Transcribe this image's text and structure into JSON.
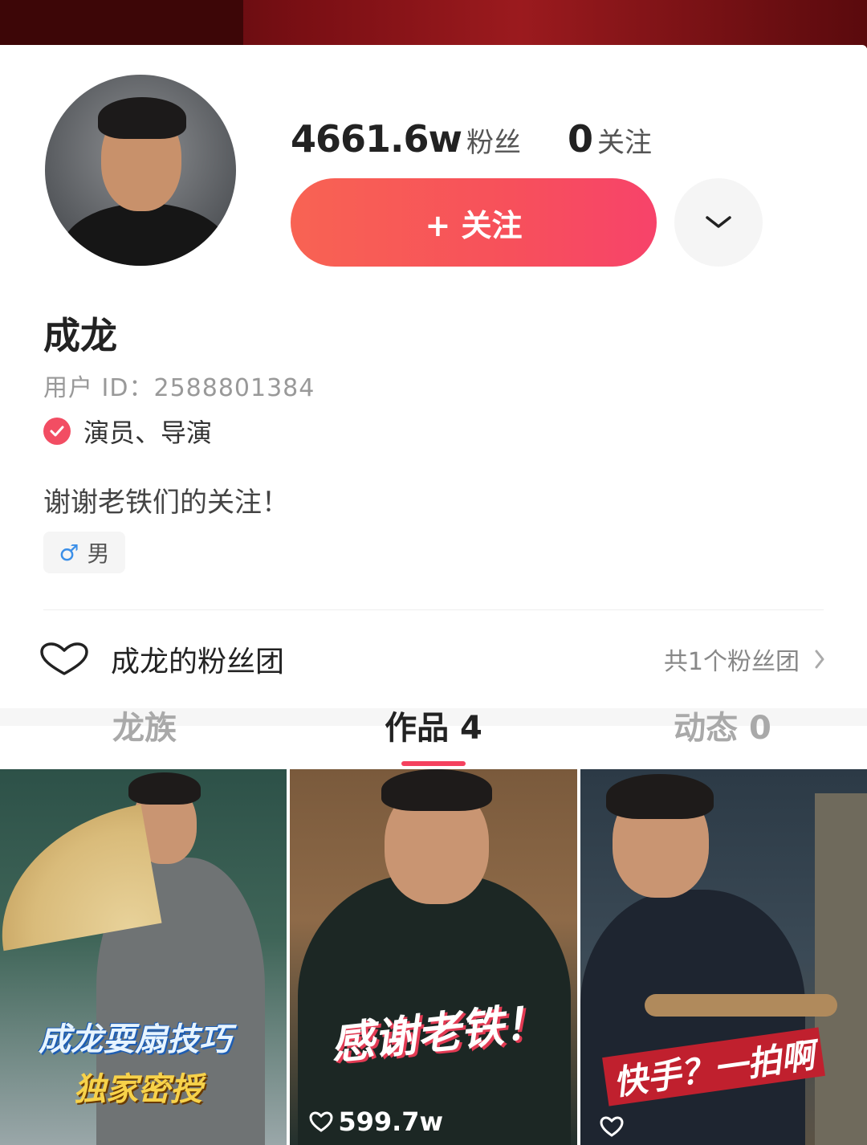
{
  "profile": {
    "fans_count": "4661.6w",
    "fans_label": "粉丝",
    "following_count": "0",
    "following_label": "关注",
    "follow_button": "+ 关注",
    "name": "成龙",
    "user_id": "用户 ID：2588801384",
    "verified_tag": "演员、导演",
    "bio": "谢谢老铁们的关注！",
    "gender": "男"
  },
  "fan_group": {
    "title": "成龙的粉丝团",
    "count_text": "共1个粉丝团"
  },
  "tabs": [
    {
      "label": "龙族"
    },
    {
      "label": "作品 4"
    },
    {
      "label": "动态 0"
    }
  ],
  "active_tab": 1,
  "works": [
    {
      "caption_line1": "成龙耍扇技巧",
      "caption_line2": "独家密授",
      "likes": ""
    },
    {
      "caption_line1": "感谢老铁！",
      "likes": "599.7w"
    },
    {
      "caption_line1": "快手？一拍啊",
      "likes": ""
    }
  ],
  "colors": {
    "accent": "#f5415e",
    "follow_gradient_start": "#f86353",
    "follow_gradient_end": "#f7436a",
    "verified": "#f24d63",
    "gender_male": "#3b8fe8"
  },
  "icons": {
    "more": "chevron-down-icon",
    "verified": "check-badge-icon",
    "gender": "male-icon",
    "fan_group": "heart-outline-icon",
    "fan_group_more": "chevron-right-icon",
    "likes": "heart-icon"
  }
}
